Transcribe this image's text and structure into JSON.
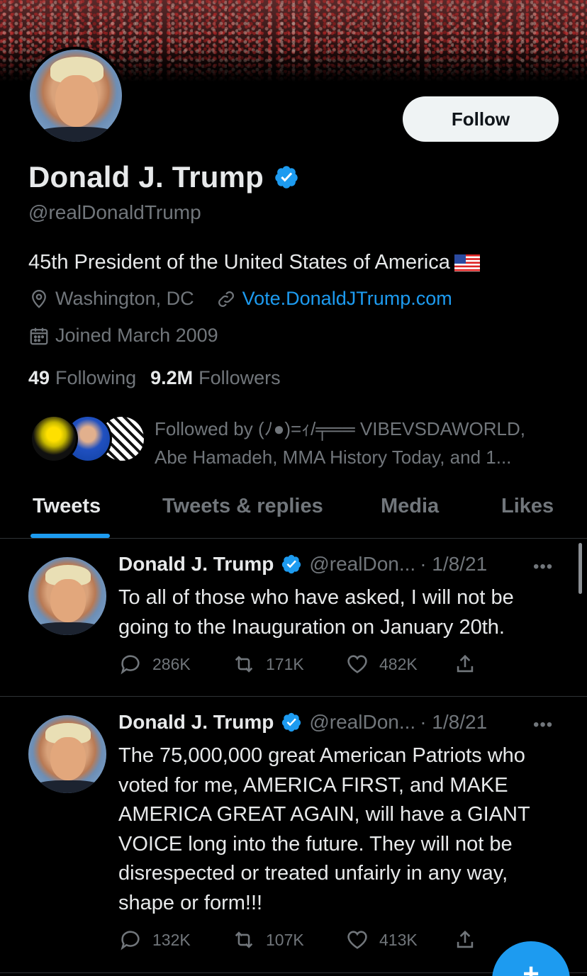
{
  "profile": {
    "follow_label": "Follow",
    "display_name": "Donald J. Trump",
    "handle": "@realDonaldTrump",
    "bio": "45th President of the United States of America",
    "location": "Washington, DC",
    "website": "Vote.DonaldJTrump.com",
    "joined": "Joined March 2009",
    "following_count": "49",
    "following_label": "Following",
    "followers_count": "9.2M",
    "followers_label": "Followers",
    "followed_by_line1": "Followed by (ﾉ●)=ｨ/╤══ VIBEVSDAWORLD,",
    "followed_by_line2": "Abe Hamadeh, MMA History Today, and 1...",
    "accent_color": "#1d9bf0",
    "icons": [
      "location-icon",
      "link-icon",
      "calendar-icon",
      "verified-icon",
      "us-flag-icon"
    ]
  },
  "tabs": [
    {
      "label": "Tweets",
      "active": true
    },
    {
      "label": "Tweets & replies",
      "active": false
    },
    {
      "label": "Media",
      "active": false
    },
    {
      "label": "Likes",
      "active": false
    }
  ],
  "tweets": [
    {
      "name": "Donald J. Trump",
      "handle": "@realDon...",
      "date": "· 1/8/21",
      "more": "•••",
      "text": "To all of those who have asked, I will not be going to the Inauguration on January 20th.",
      "replies": "286K",
      "retweets": "171K",
      "likes": "482K"
    },
    {
      "name": "Donald J. Trump",
      "handle": "@realDon...",
      "date": "· 1/8/21",
      "more": "•••",
      "text": "The 75,000,000 great American Patriots who voted for me, AMERICA FIRST, and MAKE AMERICA GREAT AGAIN, will have a GIANT VOICE long into the future. They will not be disrespected or treated unfairly in any way, shape or form!!!",
      "replies": "132K",
      "retweets": "107K",
      "likes": "413K"
    }
  ],
  "fab": {
    "label": "+"
  }
}
